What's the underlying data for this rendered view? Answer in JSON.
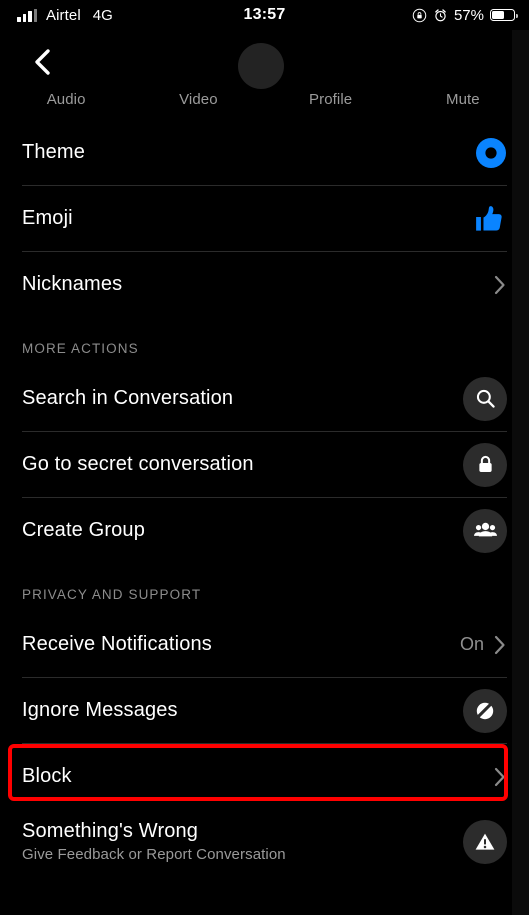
{
  "status_bar": {
    "carrier": "Airtel",
    "network": "4G",
    "time": "13:57",
    "battery_percent": "57%",
    "icons": [
      "signal-bars-icon",
      "rotation-lock-icon",
      "alarm-clock-icon",
      "battery-icon"
    ]
  },
  "header": {
    "back_icon": "back-chevron-icon",
    "avatar": "contact-avatar",
    "tabs": [
      {
        "label": "Audio",
        "icon": "audio-call-icon"
      },
      {
        "label": "Video",
        "icon": "video-call-icon"
      },
      {
        "label": "Profile",
        "icon": "profile-icon"
      },
      {
        "label": "Mute",
        "icon": "mute-icon"
      }
    ]
  },
  "sections": [
    {
      "title": "",
      "rows": [
        {
          "label": "Theme",
          "sublabel": "",
          "value": "",
          "icon": "theme-color-circle-icon",
          "accessory": "none"
        },
        {
          "label": "Emoji",
          "sublabel": "",
          "value": "",
          "icon": "thumbs-up-icon",
          "accessory": "none"
        },
        {
          "label": "Nicknames",
          "sublabel": "",
          "value": "",
          "icon": "none",
          "accessory": "chevron-right-icon"
        }
      ]
    },
    {
      "title": "MORE ACTIONS",
      "rows": [
        {
          "label": "Search in Conversation",
          "sublabel": "",
          "value": "",
          "icon": "search-icon",
          "accessory": "none"
        },
        {
          "label": "Go to secret conversation",
          "sublabel": "",
          "value": "",
          "icon": "lock-icon",
          "accessory": "none"
        },
        {
          "label": "Create Group",
          "sublabel": "",
          "value": "",
          "icon": "people-group-icon",
          "accessory": "none"
        }
      ]
    },
    {
      "title": "PRIVACY AND SUPPORT",
      "rows": [
        {
          "label": "Receive Notifications",
          "sublabel": "",
          "value": "On",
          "icon": "none",
          "accessory": "chevron-right-icon"
        },
        {
          "label": "Ignore Messages",
          "sublabel": "",
          "value": "",
          "icon": "ignore-messages-icon",
          "accessory": "none"
        },
        {
          "label": "Block",
          "sublabel": "",
          "value": "",
          "icon": "none",
          "accessory": "chevron-right-icon",
          "highlighted": true
        },
        {
          "label": "Something's Wrong",
          "sublabel": "Give Feedback or Report Conversation",
          "value": "",
          "icon": "warning-triangle-icon",
          "accessory": "none"
        }
      ]
    }
  ],
  "colors": {
    "background": "#000000",
    "accent_blue": "#0a84ff",
    "separator": "#2b2b2b",
    "badge": "#2c2c2c",
    "secondary_text": "#8f8f8f",
    "annotation_red": "#ff0000"
  }
}
